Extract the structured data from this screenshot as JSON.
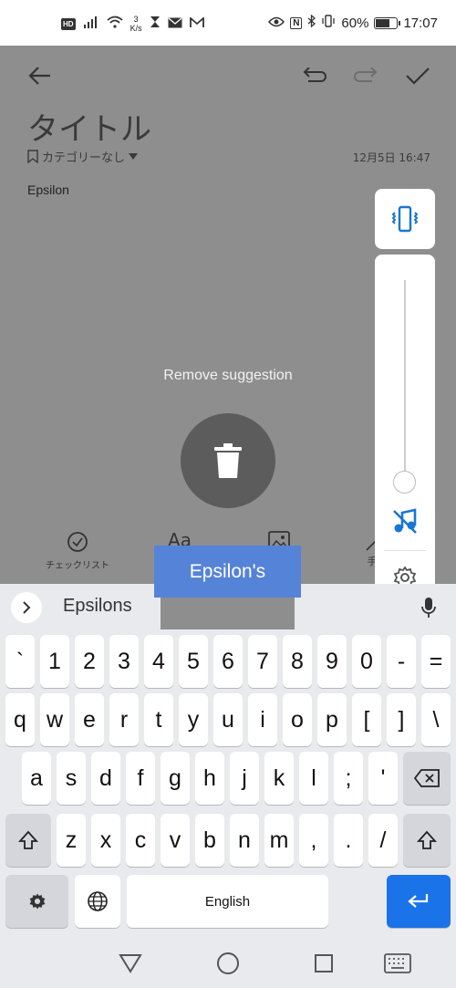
{
  "status_bar": {
    "left": {
      "hd_badge": "HD",
      "net_speed_value": "3",
      "net_speed_unit": "K/s"
    },
    "right": {
      "nfc_label": "N",
      "battery_percent": "60%",
      "battery_level": 0.6,
      "time": "17:07"
    },
    "icons": [
      "signal-icon",
      "wifi-icon",
      "hourglass-icon",
      "mail-icon",
      "gmail-icon",
      "eye-icon",
      "nfc-icon",
      "bluetooth-icon",
      "vibrate-icon",
      "battery-icon"
    ]
  },
  "note": {
    "title": "タイトル",
    "category": "カテゴリーなし",
    "datetime": "12月5日 16:47",
    "body": "Epsilon"
  },
  "overlay": {
    "remove_suggestion": "Remove suggestion"
  },
  "toolbar": {
    "checklist": "チェックリスト",
    "text_format_glyph": "Aa",
    "handwriting": "手"
  },
  "suggestions": {
    "first": "Epsilons",
    "popup": "Epsilon's"
  },
  "keyboard": {
    "rows": [
      [
        "`",
        "1",
        "2",
        "3",
        "4",
        "5",
        "6",
        "7",
        "8",
        "9",
        "0",
        "-",
        "="
      ],
      [
        "q",
        "w",
        "e",
        "r",
        "t",
        "y",
        "u",
        "i",
        "o",
        "p",
        "[",
        "]",
        "\\"
      ],
      [
        "a",
        "s",
        "d",
        "f",
        "g",
        "h",
        "j",
        "k",
        "l",
        ";",
        "'"
      ],
      [
        "z",
        "x",
        "c",
        "v",
        "b",
        "n",
        "m",
        ",",
        ".",
        "/"
      ]
    ],
    "space_label": "English"
  },
  "colors": {
    "accent": "#1a73e8",
    "popup": "#5583d8",
    "dim": "#8e8e8e",
    "volume_icon": "#1976d2"
  }
}
